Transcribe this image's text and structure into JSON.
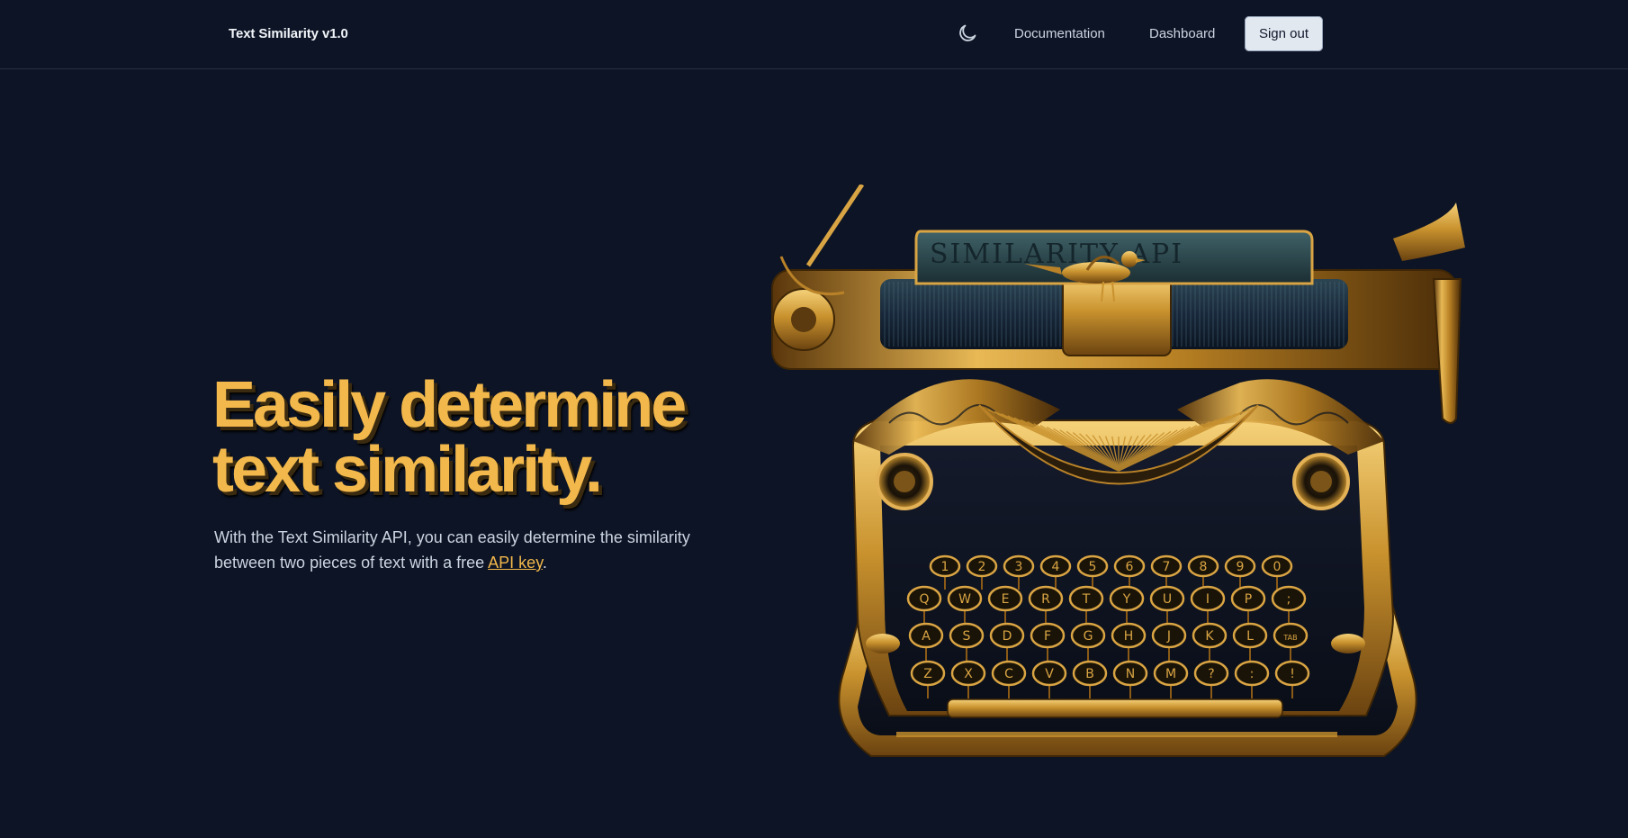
{
  "app": {
    "brand": "Text Similarity v1.0"
  },
  "nav": {
    "theme_icon": "moon-icon",
    "documentation_label": "Documentation",
    "dashboard_label": "Dashboard",
    "signout_label": "Sign out"
  },
  "hero": {
    "title": "Easily determine text similarity.",
    "subtitle_before": "With the Text Similarity API, you can easily determine the similarity between two pieces of text with a free ",
    "link_label": "API key",
    "subtitle_after": "."
  },
  "illustration": {
    "paper_text": "SIMILARITY API",
    "number_row": [
      "1",
      "2",
      "3",
      "4",
      "5",
      "6",
      "7",
      "8",
      "9",
      "0"
    ],
    "row_q": [
      "Q",
      "W",
      "E",
      "R",
      "T",
      "Y",
      "U",
      "I",
      "P",
      ";"
    ],
    "row_a": [
      "A",
      "S",
      "D",
      "F",
      "G",
      "H",
      "J",
      "K",
      "L",
      "TAB"
    ],
    "row_z": [
      "Z",
      "X",
      "C",
      "V",
      "B",
      "N",
      "M",
      "?",
      ":",
      "!"
    ]
  },
  "colors": {
    "background": "#0d1425",
    "accent": "#f2b84b",
    "button_bg": "#e2e8f0",
    "gold": "#c9922e"
  }
}
